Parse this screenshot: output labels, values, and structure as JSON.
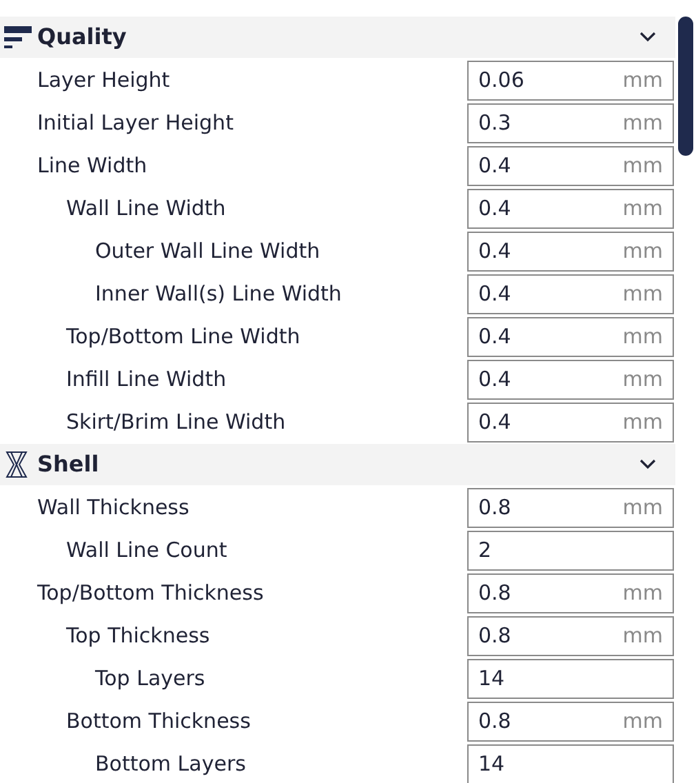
{
  "sections": [
    {
      "title": "Quality",
      "expanded": true,
      "settings": [
        {
          "label": "Layer Height",
          "value": "0.06",
          "unit": "mm"
        },
        {
          "label": "Initial Layer Height",
          "value": "0.3",
          "unit": "mm"
        },
        {
          "label": "Line Width",
          "value": "0.4",
          "unit": "mm",
          "children": [
            {
              "label": "Wall Line Width",
              "value": "0.4",
              "unit": "mm",
              "children": [
                {
                  "label": "Outer Wall Line Width",
                  "value": "0.4",
                  "unit": "mm"
                },
                {
                  "label": "Inner Wall(s) Line Width",
                  "value": "0.4",
                  "unit": "mm"
                }
              ]
            },
            {
              "label": "Top/Bottom Line Width",
              "value": "0.4",
              "unit": "mm"
            },
            {
              "label": "Infill Line Width",
              "value": "0.4",
              "unit": "mm"
            },
            {
              "label": "Skirt/Brim Line Width",
              "value": "0.4",
              "unit": "mm"
            }
          ]
        }
      ]
    },
    {
      "title": "Shell",
      "expanded": true,
      "settings": [
        {
          "label": "Wall Thickness",
          "value": "0.8",
          "unit": "mm",
          "children": [
            {
              "label": "Wall Line Count",
              "value": "2"
            }
          ]
        },
        {
          "label": "Top/Bottom Thickness",
          "value": "0.8",
          "unit": "mm",
          "children": [
            {
              "label": "Top Thickness",
              "value": "0.8",
              "unit": "mm",
              "children": [
                {
                  "label": "Top Layers",
                  "value": "14"
                }
              ]
            },
            {
              "label": "Bottom Thickness",
              "value": "0.8",
              "unit": "mm",
              "children": [
                {
                  "label": "Bottom Layers",
                  "value": "14"
                }
              ]
            }
          ]
        }
      ]
    }
  ]
}
